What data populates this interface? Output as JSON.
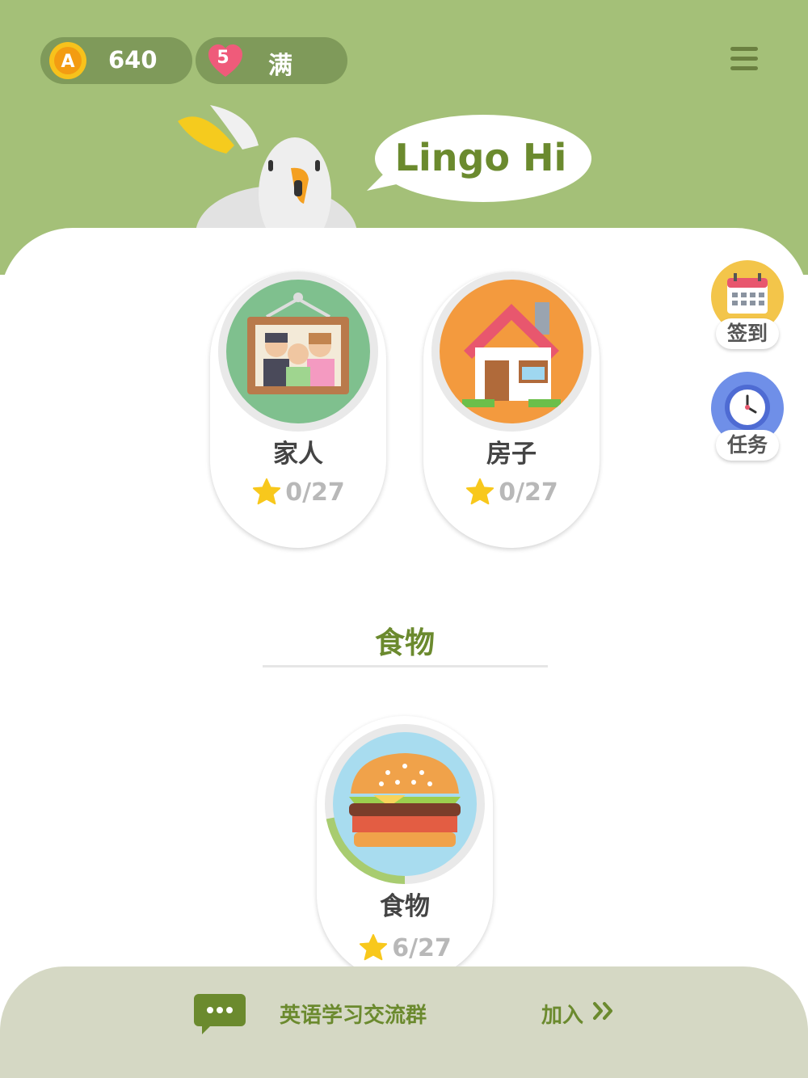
{
  "status": {
    "coins": "640",
    "hearts": "5",
    "hearts_status": "满"
  },
  "logo": {
    "text": "Lingo Hi"
  },
  "lessons": [
    {
      "title": "家人",
      "score": "0/27"
    },
    {
      "title": "房子",
      "score": "0/27"
    }
  ],
  "side": {
    "checkin_label": "签到",
    "tasks_label": "任务"
  },
  "section": {
    "title": "食物",
    "lesson": {
      "title": "食物",
      "score": "6/27",
      "progress": 0.22
    }
  },
  "footer": {
    "group_text": "英语学习交流群",
    "join_label": "加入"
  },
  "colors": {
    "header_bg": "#a4c078",
    "accent_green": "#6b8a2e",
    "footer_bg": "#d5d8c4",
    "star": "#f8c81c"
  }
}
